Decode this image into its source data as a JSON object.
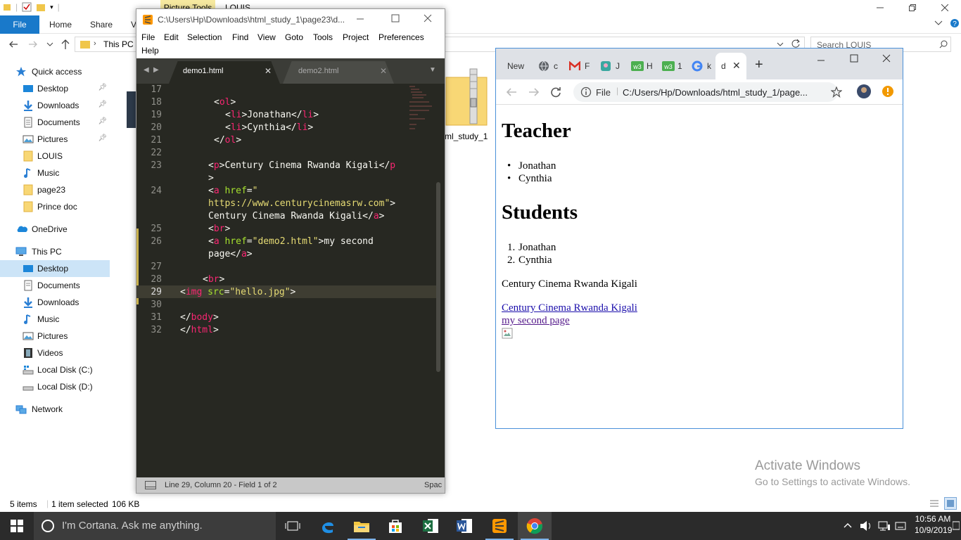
{
  "explorer": {
    "picture_tools": "Picture Tools",
    "title": "LOUIS",
    "ribbon": {
      "file": "File",
      "home": "Home",
      "share": "Share",
      "view": "V"
    },
    "breadcrumb_root": "This PC",
    "search_placeholder": "Search LOUIS",
    "nav": {
      "quick_access": "Quick access",
      "qa_items": [
        "Desktop",
        "Downloads",
        "Documents",
        "Pictures",
        "LOUIS",
        "Music",
        "page23",
        "Prince doc"
      ],
      "onedrive": "OneDrive",
      "this_pc": "This PC",
      "pc_items": [
        "Desktop",
        "Documents",
        "Downloads",
        "Music",
        "Pictures",
        "Videos",
        "Local Disk (C:)",
        "Local Disk (D:)"
      ],
      "network": "Network"
    },
    "folder_label": "ml_study_1",
    "status": {
      "items": "5 items",
      "selected": "1 item selected",
      "size": "106 KB"
    }
  },
  "sublime": {
    "title": "C:\\Users\\Hp\\Downloads\\html_study_1\\page23\\d...",
    "menu": [
      "File",
      "Edit",
      "Selection",
      "Find",
      "View",
      "Goto",
      "Tools",
      "Project",
      "Preferences",
      "Help"
    ],
    "tabs": [
      {
        "label": "demo1.html"
      },
      {
        "label": "demo2.html"
      }
    ],
    "line_numbers": [
      "17",
      "18",
      "19",
      "20",
      "21",
      "22",
      "23",
      "24",
      "25",
      "26",
      "27",
      "28",
      "29",
      "30",
      "31",
      "32"
    ],
    "code": {
      "l18": {
        "o": "<",
        "t": "ol",
        "c": ">"
      },
      "l19": {
        "o": "<",
        "t": "li",
        "m": ">Jonathan</",
        "t2": "li",
        "c": ">"
      },
      "l20": {
        "o": "<",
        "t": "li",
        "m": ">Cynthia</",
        "t2": "li",
        "c": ">"
      },
      "l21": {
        "o": "</",
        "t": "ol",
        "c": ">"
      },
      "l23a": {
        "o": "<",
        "t": "p",
        "m": ">Century Cinema Rwanda Kigali</",
        "t2": "p"
      },
      "l23b": ">",
      "l24a": {
        "o": "<",
        "t": "a",
        "sp": " ",
        "attr": "href",
        "eq": "=",
        "val": "\""
      },
      "l24b": {
        "val": "https://www.centurycinemasrw.com\"",
        "c": ">"
      },
      "l24c": {
        "m": "Century Cinema Rwanda Kigali</",
        "t": "a",
        "c": ">"
      },
      "l25": {
        "o": "<",
        "t": "br",
        "c": ">"
      },
      "l26a": {
        "o": "<",
        "t": "a",
        "sp": " ",
        "attr": "href",
        "eq": "=",
        "val": "\"demo2.html\"",
        "m": ">my second"
      },
      "l26b": {
        "m": "page</",
        "t": "a",
        "c": ">"
      },
      "l28": {
        "o": "<",
        "t": "br",
        "c": ">"
      },
      "l29": {
        "o": "<",
        "t": "img",
        "sp": " ",
        "attr": "src",
        "eq": "=",
        "val": "\"hello.jpg\"",
        "c": ">"
      },
      "l31": {
        "o": "</",
        "t": "body",
        "c": ">"
      },
      "l32": {
        "o": "</",
        "t": "html",
        "c": ">"
      }
    },
    "status": "Line 29, Column 20 - Field 1 of 2",
    "status_right": "Spac"
  },
  "chrome": {
    "tabs": [
      {
        "label": "New"
      },
      {
        "label": "c"
      },
      {
        "label": "F"
      },
      {
        "label": "J"
      },
      {
        "label": "H"
      },
      {
        "label": "1"
      },
      {
        "label": "k"
      },
      {
        "label": "d"
      }
    ],
    "file_label": "File",
    "url": "C:/Users/Hp/Downloads/html_study_1/page...",
    "page": {
      "h1_teacher": "Teacher",
      "teacher_list": [
        "Jonathan",
        "Cynthia"
      ],
      "h1_students": "Students",
      "student_list": [
        "Jonathan",
        "Cynthia"
      ],
      "paragraph": "Century Cinema Rwanda Kigali",
      "link1": "Century Cinema Rwanda Kigali",
      "link2": "my second page"
    }
  },
  "watermark": {
    "title": "Activate Windows",
    "sub": "Go to Settings to activate Windows."
  },
  "taskbar": {
    "cortana": "I'm Cortana. Ask me anything.",
    "time": "10:56 AM",
    "date": "10/9/2019"
  },
  "colors": {
    "accent": "#1979ca",
    "sublime_bg": "#272822",
    "taskbar": "#2b2b2b",
    "link": "#1a0dab",
    "visited": "#551a8b"
  }
}
